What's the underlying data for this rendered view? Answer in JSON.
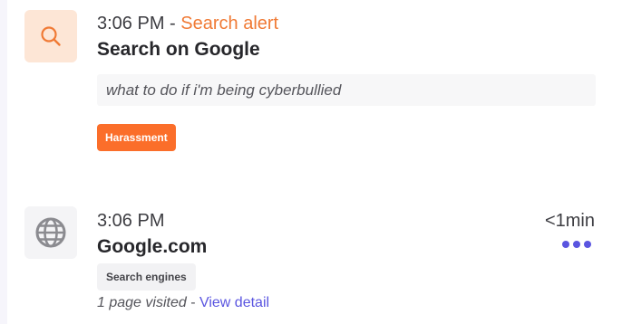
{
  "activities": [
    {
      "time": "3:06 PM",
      "separator": "-",
      "alert_label": "Search alert",
      "title": "Search on Google",
      "query": "what to do if i'm being cyberbullied",
      "category_tag": "Harassment",
      "icon": "search-icon",
      "accent_color": "#f07a35"
    },
    {
      "time": "3:06 PM",
      "title": "Google.com",
      "category_tag": "Search engines",
      "pages_visited": "1 page visited",
      "separator": "-",
      "link_label": "View detail",
      "duration": "<1min",
      "icon": "globe-icon",
      "link_color": "#5a55e0"
    }
  ]
}
